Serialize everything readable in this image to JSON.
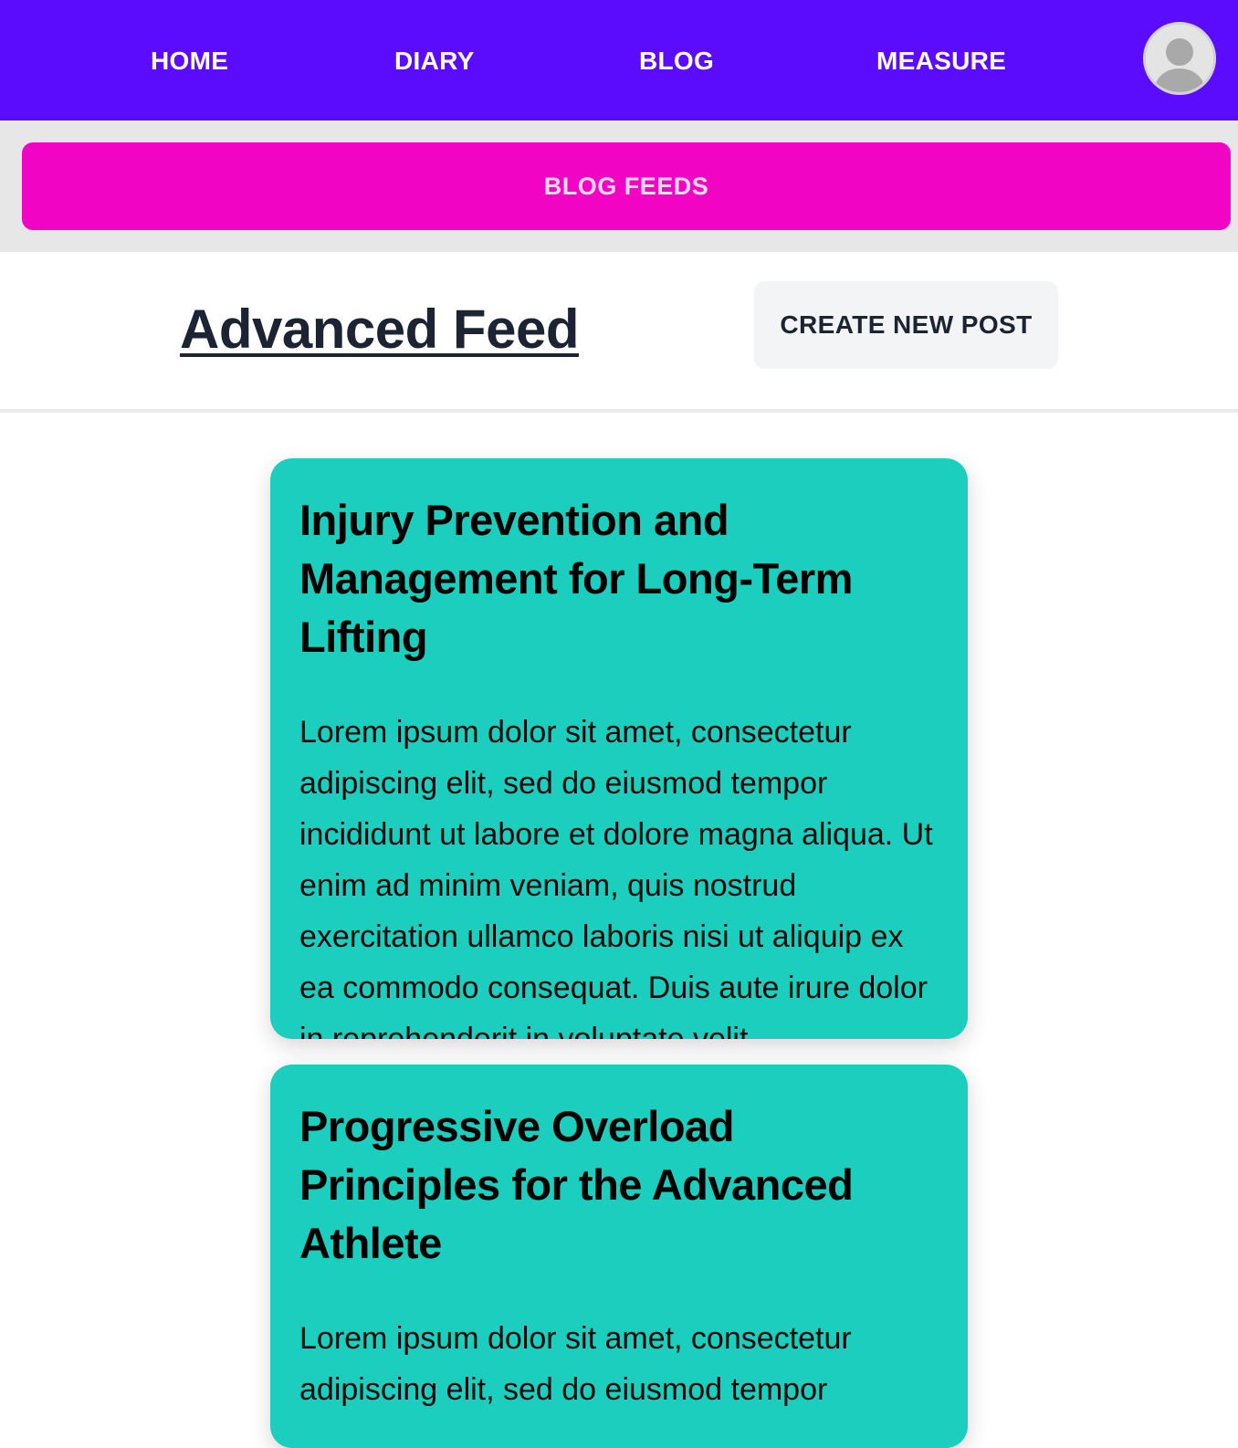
{
  "nav": {
    "home": "HOME",
    "diary": "DIARY",
    "blog": "BLOG",
    "measure": "MEASURE",
    "avatar_icon": "user-avatar-icon"
  },
  "feeds": {
    "label": "BLOG FEEDS"
  },
  "header": {
    "title": "Advanced Feed",
    "create_button": "CREATE NEW POST"
  },
  "posts": [
    {
      "title": "Injury Prevention and Management for Long-Term Lifting",
      "body": "Lorem ipsum dolor sit amet, consectetur adipiscing elit, sed do eiusmod tempor incididunt ut labore et dolore magna aliqua. Ut enim ad minim veniam, quis nostrud exercitation ullamco laboris nisi ut aliquip ex ea commodo consequat. Duis aute irure dolor in reprehenderit in voluptate velit"
    },
    {
      "title": "Progressive Overload Principles for the Advanced Athlete",
      "body": "Lorem ipsum dolor sit amet, consectetur adipiscing elit, sed do eiusmod tempor"
    }
  ],
  "colors": {
    "navbar": "#5b0cfd",
    "feeds_button": "#f104c3",
    "card": "#1ccebd"
  }
}
